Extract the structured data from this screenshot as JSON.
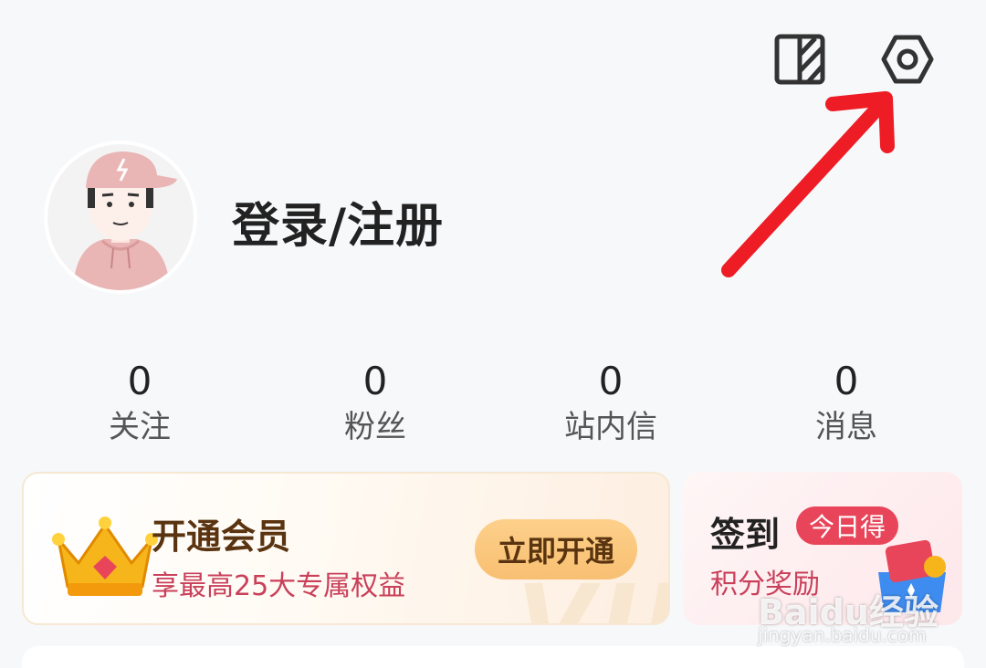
{
  "header": {
    "theme_icon": "theme-toggle-icon",
    "settings_icon": "settings-hexagon-icon"
  },
  "profile": {
    "login_label": "登录/注册",
    "avatar_icon": "default-avatar-icon"
  },
  "stats": [
    {
      "value": "0",
      "label": "关注"
    },
    {
      "value": "0",
      "label": "粉丝"
    },
    {
      "value": "0",
      "label": "站内信"
    },
    {
      "value": "0",
      "label": "消息"
    }
  ],
  "vip": {
    "title": "开通会员",
    "subtitle": "享最高25大专属权益",
    "button": "立即开通",
    "watermark": "VIP",
    "icon": "crown-icon"
  },
  "sign_in": {
    "title": "签到",
    "badge": "今日得",
    "subtitle": "积分奖励",
    "icon": "gift-box-icon"
  },
  "watermark": {
    "brand": "Baidu经验",
    "url": "jingyan.baidu.com"
  },
  "colors": {
    "accent_red": "#e8455a",
    "vip_brown": "#5a3410",
    "vip_button": "#f8bf72",
    "arrow_red": "#ee1c24"
  }
}
